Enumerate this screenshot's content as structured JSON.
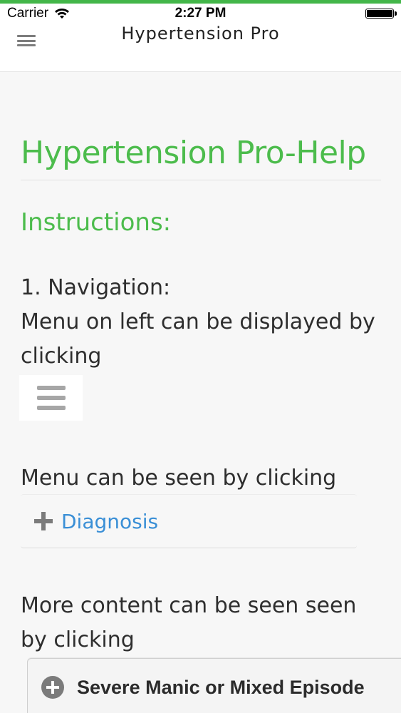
{
  "status_bar": {
    "carrier": "Carrier",
    "time": "2:27 PM",
    "wifi_icon": "wifi-icon",
    "battery_icon": "battery-icon"
  },
  "nav_bar": {
    "title": "Hypertension Pro",
    "menu_icon": "hamburger-menu-icon"
  },
  "content": {
    "page_heading": "Hypertension Pro-Help",
    "section_heading": "Instructions:",
    "nav_step_title": "1. Navigation:",
    "nav_step_line1": "Menu on left can be displayed by",
    "nav_step_line2": "clicking",
    "menu_seen_text": "Menu can be seen by clicking",
    "diagnosis_item": {
      "icon": "plus-icon",
      "label": "Diagnosis"
    },
    "more_content_line1": "More content can be seen seen",
    "more_content_line2": "by clicking",
    "episode_item": {
      "icon": "circle-plus-icon",
      "label": "Severe Manic or Mixed Episode"
    }
  },
  "colors": {
    "accent_green": "#4cbc4c",
    "link_blue": "#3a8fd6",
    "top_line": "#43b649"
  }
}
